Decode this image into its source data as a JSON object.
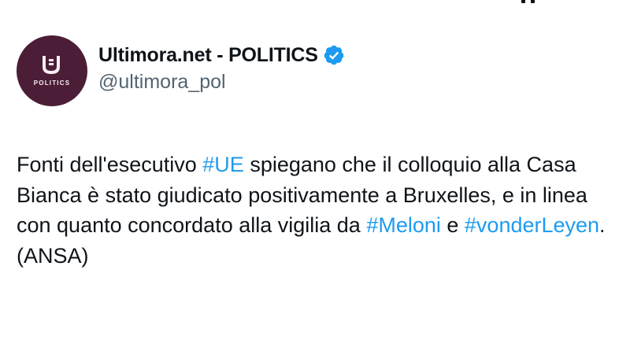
{
  "account": {
    "avatar_caption": "POLITICS",
    "display_name": "Ultimora.net - POLITICS",
    "handle": "@ultimora_pol"
  },
  "tweet": {
    "segments": [
      "Fonti dell'esecutivo ",
      "#UE",
      " spiegano che il colloquio alla Casa Bianca è stato giudicato positivamente a Bruxelles, e in linea con quanto concordato alla vigilia da ",
      "#Meloni",
      " e ",
      "#vonderLeyen",
      ". (ANSA)"
    ]
  },
  "icons": {
    "avatar_logo": "ultimora-u-logo-icon",
    "verified": "verified-badge-icon"
  },
  "colors": {
    "avatar_bg": "#4b1d36",
    "hashtag": "#1d9bf0",
    "verified": "#1d9bf0",
    "text": "#0f1419",
    "secondary_text": "#536471"
  }
}
